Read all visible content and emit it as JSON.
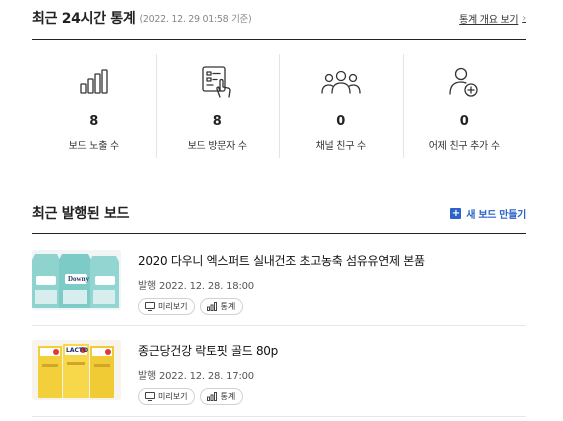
{
  "stats": {
    "title": "최근 24시간 통계",
    "date": "(2022. 12. 29 01:58 기준)",
    "overview_link": "통계 개요 보기",
    "items": [
      {
        "icon": "bar-chart-icon",
        "value": "8",
        "label": "보드 노출 수"
      },
      {
        "icon": "touch-document-icon",
        "value": "8",
        "label": "보드 방문자 수"
      },
      {
        "icon": "people-group-icon",
        "value": "0",
        "label": "채널 친구 수"
      },
      {
        "icon": "add-friend-icon",
        "value": "0",
        "label": "어제 친구 추가 수"
      }
    ]
  },
  "boards": {
    "title": "최근 발행된 보드",
    "new_board": "새 보드 만들기",
    "preview_label": "미리보기",
    "stats_label": "통계",
    "items": [
      {
        "title": "2020 다우니 엑스퍼트 실내건조 초고농축 섬유유연제 본품",
        "date": "발행 2022. 12. 28. 18:00",
        "thumb_text": "Downy"
      },
      {
        "title": "종근당건강 락토핏 골드 80p",
        "date": "발행 2022. 12. 28. 17:00",
        "thumb_text": "LACTO"
      }
    ]
  },
  "colors": {
    "accent": "#2b63c8"
  }
}
